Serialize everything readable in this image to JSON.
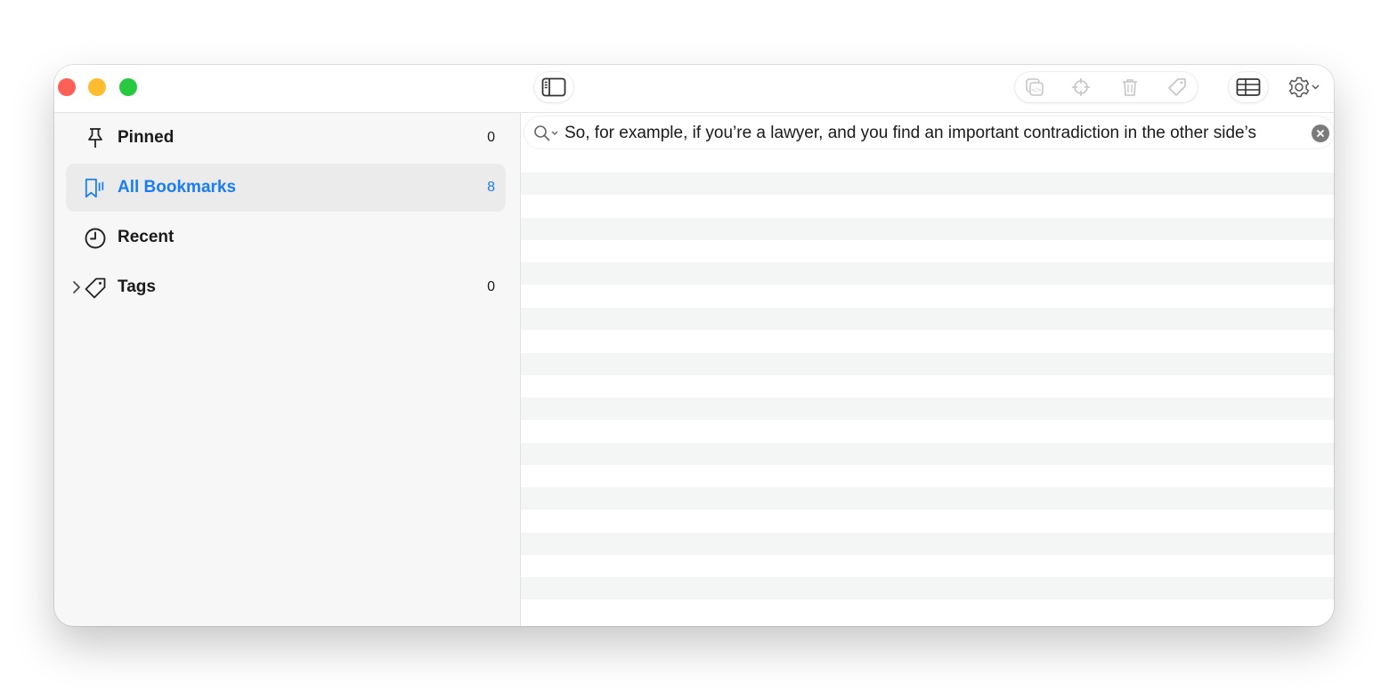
{
  "window": {
    "traffic_lights": [
      "close",
      "minimize",
      "zoom"
    ]
  },
  "toolbar": {
    "sidebar_toggle_icon": "sidebar-toggle-icon",
    "actions": [
      "copy-link-icon",
      "crosshair-icon",
      "trash-icon",
      "tag-icon"
    ],
    "view_icon": "table-view-icon",
    "settings_icon": "gear-icon"
  },
  "sidebar": {
    "items": [
      {
        "label": "Pinned",
        "count": "0",
        "icon": "pin-icon"
      },
      {
        "label": "All Bookmarks",
        "count": "8",
        "icon": "bookmarks-icon",
        "selected": true
      },
      {
        "label": "Recent",
        "count": "",
        "icon": "clock-icon"
      },
      {
        "label": "Tags",
        "count": "0",
        "icon": "tag-icon"
      }
    ]
  },
  "search": {
    "value": "So, for example, if you’re a lawyer, and you find an important contradiction in the other side’s"
  },
  "colors": {
    "accent": "#1a7cf5",
    "close": "#fe5f57",
    "minimize": "#febc2e",
    "zoom": "#28c840",
    "stripe": "#f4f5f5"
  }
}
